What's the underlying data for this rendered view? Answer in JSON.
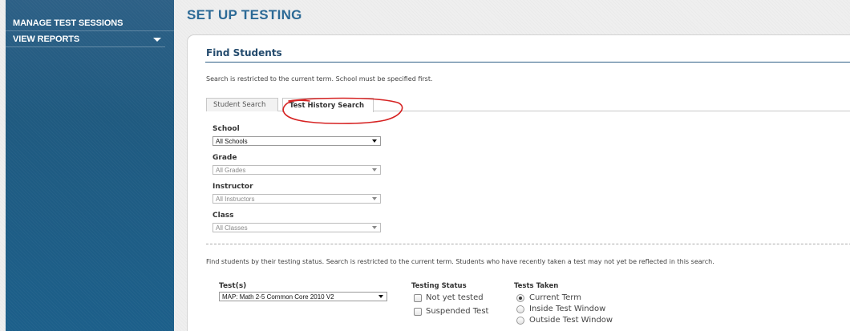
{
  "sidebar": {
    "items": [
      {
        "label": "MANAGE TEST SESSIONS"
      },
      {
        "label": "VIEW REPORTS",
        "icon": "caret-down-icon"
      }
    ]
  },
  "page": {
    "title": "SET UP TESTING"
  },
  "panel": {
    "title": "Find Students",
    "restriction_note": "Search is restricted to the current term. School must be specified first.",
    "tabs": [
      {
        "label": "Student Search",
        "selected": false
      },
      {
        "label": "Test History Search",
        "selected": true,
        "annotated": true
      }
    ],
    "annotation_color": "#d62323"
  },
  "form": {
    "school": {
      "label": "School",
      "value": "All Schools"
    },
    "grade": {
      "label": "Grade",
      "value": "All Grades"
    },
    "instructor": {
      "label": "Instructor",
      "value": "All Instructors"
    },
    "class": {
      "label": "Class",
      "value": "All Classes"
    }
  },
  "testing": {
    "description": "Find students by their testing status. Search is restricted to the current term. Students who have recently taken a test may not yet be reflected in this search.",
    "tests": {
      "label": "Test(s)",
      "value": "MAP: Math 2-5 Common Core 2010 V2"
    },
    "status": {
      "label": "Testing Status",
      "options": [
        {
          "label": "Not yet tested",
          "checked": false
        },
        {
          "label": "Suspended Test",
          "checked": false
        }
      ]
    },
    "taken": {
      "label": "Tests Taken",
      "options": [
        {
          "label": "Current Term",
          "selected": true
        },
        {
          "label": "Inside Test Window",
          "selected": false
        },
        {
          "label": "Outside Test Window",
          "selected": false
        }
      ]
    }
  },
  "colors": {
    "sidebar": "#1f5a80",
    "title": "#2c6a96",
    "panel_title": "#244b6d"
  }
}
